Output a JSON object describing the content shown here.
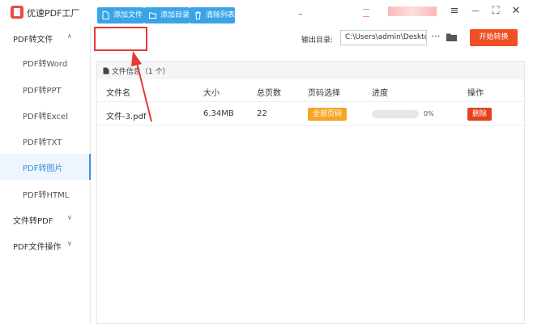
{
  "app": {
    "title": "优速PDF工厂"
  },
  "window": {
    "menu_icon": "≡",
    "minimize_icon": "—",
    "maximize_icon": "⛶",
    "close_icon": "✕"
  },
  "sidebar": {
    "groups": [
      {
        "label": "PDF转文件",
        "chevron": "∧",
        "expanded": true
      },
      {
        "label": "文件转PDF",
        "chevron": "∨",
        "expanded": false
      },
      {
        "label": "PDF文件操作",
        "chevron": "∨",
        "expanded": false
      }
    ],
    "items": [
      {
        "label": "PDF转Word"
      },
      {
        "label": "PDF转PPT"
      },
      {
        "label": "PDF转Excel"
      },
      {
        "label": "PDF转TXT"
      },
      {
        "label": "PDF转图片",
        "active": true
      },
      {
        "label": "PDF转HTML"
      }
    ]
  },
  "toolbar": {
    "add_file": "添加文件",
    "add_folder": "添加目录",
    "clear_list": "清除列表",
    "output_label": "输出目录:",
    "output_path": "C:\\Users\\admin\\Deskto",
    "more": "···",
    "start": "开始转换"
  },
  "file_panel": {
    "title": "文件信息（1 个）",
    "columns": [
      "文件名",
      "大小",
      "总页数",
      "页码选择",
      "进度",
      "操作"
    ],
    "rows": [
      {
        "name": "文件-3.pdf",
        "size": "6.34MB",
        "pages": "22",
        "page_select": "全部页码",
        "progress_label": "0%",
        "progress": 0,
        "action": "删除"
      }
    ]
  },
  "colors": {
    "accent_blue": "#3aa4e8",
    "start_orange": "#f04e23",
    "page_select_orange": "#f5a623",
    "delete_red": "#e5421c",
    "annotation_red": "#e53935",
    "active_blue": "#3a8ee6"
  },
  "icons": {
    "logo": "pdf-logo-icon",
    "add_file": "file-icon",
    "add_folder": "folder-icon",
    "clear_list": "trash-icon",
    "browse": "folder-icon",
    "panel": "file-icon"
  }
}
